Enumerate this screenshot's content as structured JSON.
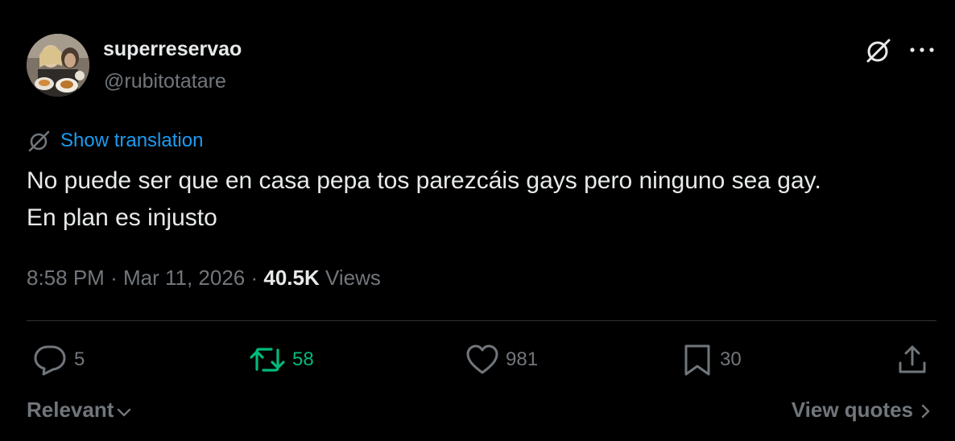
{
  "author": {
    "display_name": "superreservao",
    "handle": "@rubitotatare"
  },
  "translation": {
    "label": "Show translation"
  },
  "tweet": {
    "line1": "No puede ser que en casa pepa tos parezcáis gays pero ninguno sea gay.",
    "line2": "En plan es injusto"
  },
  "meta": {
    "time": "8:58 PM",
    "separator": "·",
    "date": "Mar 11, 2026",
    "views_count": "40.5K",
    "views_label": "Views"
  },
  "actions": {
    "replies": "5",
    "reposts": "58",
    "likes": "981",
    "bookmarks": "30"
  },
  "footer": {
    "sort_label": "Relevant",
    "quotes_label": "View quotes"
  },
  "icons": {
    "grok": "grok-icon",
    "more": "more-icon",
    "translate": "translate-icon",
    "reply": "reply-icon",
    "repost": "repost-icon",
    "like": "heart-icon",
    "bookmark": "bookmark-icon",
    "share": "share-icon",
    "chevron_down": "chevron-down-icon",
    "chevron_right": "chevron-right-icon"
  },
  "colors": {
    "background": "#000000",
    "text_primary": "#e7e9ea",
    "text_secondary": "#71767b",
    "link": "#1d9bf0",
    "repost_active": "#00ba7c",
    "divider": "#2f3336"
  }
}
